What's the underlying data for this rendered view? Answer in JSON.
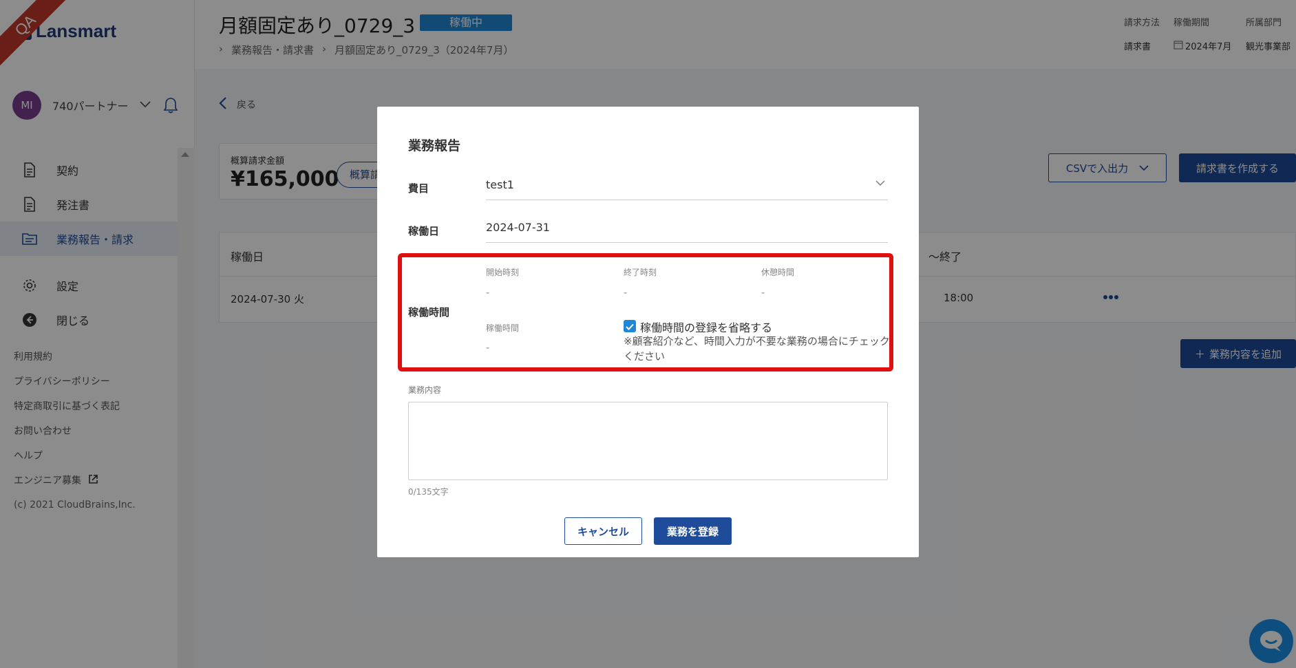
{
  "app": {
    "logo_text": "Lansmart",
    "env_ribbon": "QA"
  },
  "user": {
    "initials": "MI",
    "name": "740パートナー"
  },
  "sidebar": {
    "items": [
      {
        "label": "契約"
      },
      {
        "label": "発注書"
      },
      {
        "label": "業務報告・請求"
      },
      {
        "label": "設定"
      },
      {
        "label": "閉じる"
      }
    ],
    "links": [
      "利用規約",
      "プライバシーポリシー",
      "特定商取引に基づく表記",
      "お問い合わせ",
      "ヘルプ",
      "エンジニア募集"
    ],
    "copyright": "(c) 2021 CloudBrains,Inc."
  },
  "header": {
    "title": "月額固定あり_0729_3",
    "status": "稼働中",
    "breadcrumb": [
      "業務報告・請求書",
      "月額固定あり_0729_3（2024年7月）"
    ],
    "meta": [
      {
        "label": "請求方法",
        "value": "請求書"
      },
      {
        "label": "稼働期間",
        "value": "2024年7月"
      },
      {
        "label": "所属部門",
        "value": "観光事業部"
      }
    ]
  },
  "main": {
    "back_label": "戻る",
    "amount_label": "概算請求金額",
    "amount_value": "¥165,000",
    "amount_button": "概算請",
    "csv_button": "CSVで入出力",
    "create_invoice_button": "請求書を作成する",
    "table": {
      "header_date": "稼働日",
      "header_time": "～終了",
      "row": {
        "date": "2024-07-30 火",
        "end": "18:00"
      }
    },
    "add_button": "業務内容を追加"
  },
  "modal": {
    "title": "業務報告",
    "expense_label": "費目",
    "expense_value": "test1",
    "date_label": "稼働日",
    "date_value": "2024-07-31",
    "work_time_label": "稼働時間",
    "start_label": "開始時刻",
    "end_label": "終了時刻",
    "break_label": "休憩時間",
    "duration_label": "稼働時間",
    "placeholder_dash": "-",
    "skip_checkbox_label": "稼働時間の登録を省略する",
    "skip_checkbox_checked": true,
    "skip_note": "※顧客紹介など、時間入力が不要な業務の場合にチェックください",
    "description_label": "業務内容",
    "description_value": "",
    "char_counter": "0/135文字",
    "cancel_button": "キャンセル",
    "submit_button": "業務を登録"
  },
  "colors": {
    "brand": "#1e4b9a",
    "status": "#1e87d6",
    "highlight": "#e01010",
    "avatar": "#7a3d91"
  }
}
